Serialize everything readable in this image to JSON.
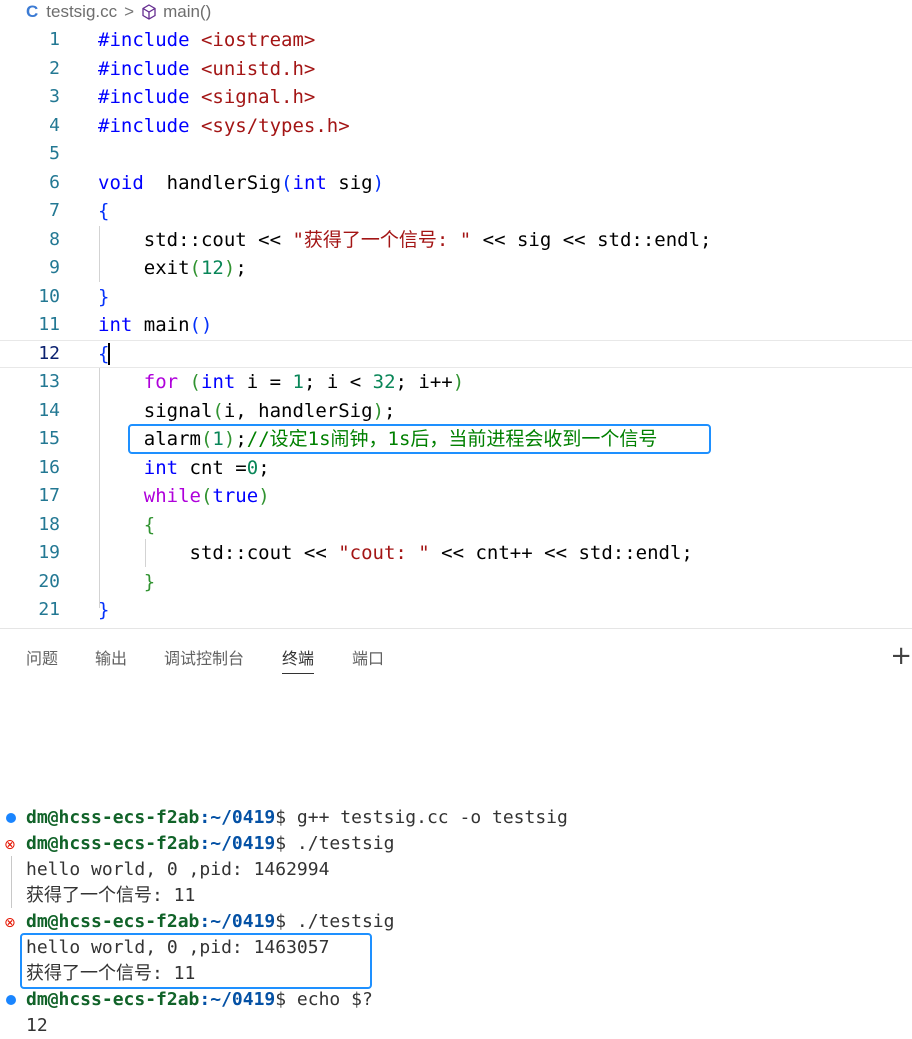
{
  "breadcrumb": {
    "file_icon": "C",
    "file": "testsig.cc",
    "separator": ">",
    "symbol": "main()"
  },
  "editor": {
    "lines": [
      {
        "n": "1",
        "t": [
          [
            "inc",
            "#include "
          ],
          [
            "hdr",
            "<iostream>"
          ]
        ]
      },
      {
        "n": "2",
        "t": [
          [
            "inc",
            "#include "
          ],
          [
            "hdr",
            "<unistd.h>"
          ]
        ]
      },
      {
        "n": "3",
        "t": [
          [
            "inc",
            "#include "
          ],
          [
            "hdr",
            "<signal.h>"
          ]
        ]
      },
      {
        "n": "4",
        "t": [
          [
            "inc",
            "#include "
          ],
          [
            "hdr",
            "<sys/types.h>"
          ]
        ]
      },
      {
        "n": "5",
        "t": []
      },
      {
        "n": "6",
        "t": [
          [
            "k",
            "void"
          ],
          [
            "",
            "  handlerSig"
          ],
          [
            "br1",
            "("
          ],
          [
            "k",
            "int"
          ],
          [
            "",
            " sig"
          ],
          [
            "br1",
            ")"
          ]
        ]
      },
      {
        "n": "7",
        "t": [
          [
            "br1",
            "{"
          ]
        ]
      },
      {
        "n": "8",
        "t": [
          [
            "",
            "    std::cout << "
          ],
          [
            "str",
            "\"获得了一个信号: \""
          ],
          [
            "",
            " << sig << std::endl;"
          ]
        ]
      },
      {
        "n": "9",
        "t": [
          [
            "",
            "    exit"
          ],
          [
            "br2",
            "("
          ],
          [
            "num",
            "12"
          ],
          [
            "br2",
            ")"
          ],
          [
            "",
            ";"
          ]
        ]
      },
      {
        "n": "10",
        "t": [
          [
            "br1",
            "}"
          ]
        ]
      },
      {
        "n": "11",
        "t": [
          [
            "k",
            "int"
          ],
          [
            "",
            " main"
          ],
          [
            "br1",
            "()"
          ]
        ]
      },
      {
        "n": "12",
        "t": [
          [
            "br1",
            "{"
          ]
        ]
      },
      {
        "n": "13",
        "t": [
          [
            "",
            "    "
          ],
          [
            "kc",
            "for"
          ],
          [
            "",
            " "
          ],
          [
            "br2",
            "("
          ],
          [
            "k",
            "int"
          ],
          [
            "",
            " i = "
          ],
          [
            "num",
            "1"
          ],
          [
            "",
            ";"
          ],
          [
            "",
            " i < "
          ],
          [
            "num",
            "32"
          ],
          [
            "",
            ";"
          ],
          [
            "",
            " i++"
          ],
          [
            "br2",
            ")"
          ]
        ]
      },
      {
        "n": "14",
        "t": [
          [
            "",
            "    signal"
          ],
          [
            "br2",
            "("
          ],
          [
            "",
            "i, handlerSig"
          ],
          [
            "br2",
            ")"
          ],
          [
            "",
            ";"
          ]
        ]
      },
      {
        "n": "15",
        "t": [
          [
            "",
            "    alarm"
          ],
          [
            "br2",
            "("
          ],
          [
            "num",
            "1"
          ],
          [
            "br2",
            ")"
          ],
          [
            "",
            ";"
          ],
          [
            "cmt",
            "//设定1s闹钟，1s后，当前进程会收到一个信号"
          ]
        ]
      },
      {
        "n": "16",
        "t": [
          [
            "",
            "    "
          ],
          [
            "k",
            "int"
          ],
          [
            "",
            " cnt ="
          ],
          [
            "num",
            "0"
          ],
          [
            "",
            ";"
          ]
        ]
      },
      {
        "n": "17",
        "t": [
          [
            "",
            "    "
          ],
          [
            "kc",
            "while"
          ],
          [
            "br2",
            "("
          ],
          [
            "k",
            "true"
          ],
          [
            "br2",
            ")"
          ]
        ]
      },
      {
        "n": "18",
        "t": [
          [
            "",
            "    "
          ],
          [
            "br2",
            "{"
          ]
        ]
      },
      {
        "n": "19",
        "t": [
          [
            "",
            "        std::cout << "
          ],
          [
            "str",
            "\"cout: \""
          ],
          [
            "",
            " << cnt++ << std::endl;"
          ]
        ]
      },
      {
        "n": "20",
        "t": [
          [
            "",
            "    "
          ],
          [
            "br2",
            "}"
          ]
        ]
      },
      {
        "n": "21",
        "t": [
          [
            "br1",
            "}"
          ]
        ]
      }
    ]
  },
  "panel": {
    "tabs": [
      "问题",
      "输出",
      "调试控制台",
      "终端",
      "端口"
    ],
    "active_tab": "终端",
    "plus": "+"
  },
  "terminal": {
    "lines": [
      {
        "status": "ok",
        "user": "dm@hcss-ecs-f2ab",
        "path": ":~/0419",
        "cmd": "$ g++ testsig.cc -o testsig"
      },
      {
        "status": "err",
        "user": "dm@hcss-ecs-f2ab",
        "path": ":~/0419",
        "cmd": "$ ./testsig"
      },
      {
        "out": "hello world, 0 ,pid: 1462994"
      },
      {
        "out": "获得了一个信号: 11"
      },
      {
        "status": "err",
        "user": "dm@hcss-ecs-f2ab",
        "path": ":~/0419",
        "cmd": "$ ./testsig"
      },
      {
        "out": "hello world, 0 ,pid: 1463057"
      },
      {
        "out": "获得了一个信号: 11"
      },
      {
        "status": "ok",
        "user": "dm@hcss-ecs-f2ab",
        "path": ":~/0419",
        "cmd": "$ echo $?"
      },
      {
        "out": "12"
      }
    ]
  },
  "colors": {
    "highlight_box": "#1e90ff",
    "line_number": "#237893"
  }
}
